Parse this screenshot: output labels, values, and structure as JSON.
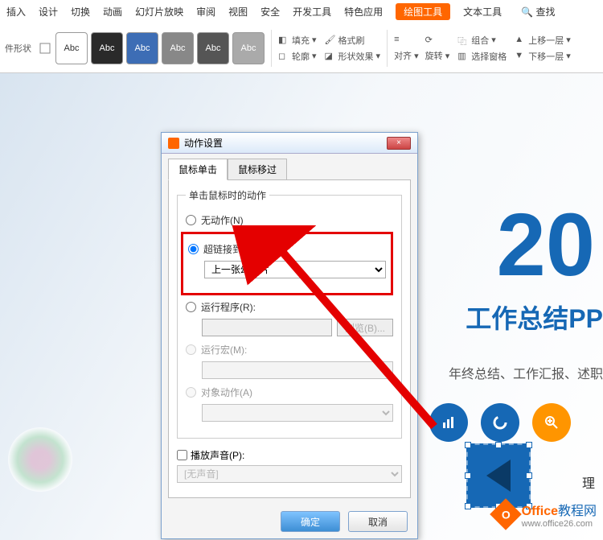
{
  "ribbon": {
    "tabs": [
      "插入",
      "设计",
      "切换",
      "动画",
      "幻灯片放映",
      "审阅",
      "视图",
      "安全",
      "开发工具",
      "特色应用",
      "绘图工具",
      "文本工具"
    ],
    "active_tab_index": 10,
    "search": "查找"
  },
  "toolbar": {
    "shape_label": "件形状",
    "abc": "Abc",
    "fill": "填充",
    "outline": "轮廓",
    "format_painter": "格式刷",
    "shape_effects": "形状效果",
    "align": "对齐",
    "rotate": "旋转",
    "group": "组合",
    "selection_pane": "选择窗格",
    "bring_forward": "上移一层",
    "send_backward": "下移一层"
  },
  "slide": {
    "big_number": "20",
    "big_title": "工作总结PP",
    "subtitle": "年终总结、工作汇报、述职",
    "reason": "理"
  },
  "dialog": {
    "title": "动作设置",
    "close": "×",
    "tab1": "鼠标单击",
    "tab2": "鼠标移过",
    "group_label": "单击鼠标时的动作",
    "opt_none": "无动作(N)",
    "opt_hyperlink": "超链接到(H):",
    "hyperlink_target": "上一张幻灯片",
    "opt_run_program": "运行程序(R):",
    "browse": "浏览(B)...",
    "opt_run_macro": "运行宏(M):",
    "opt_object_action": "对象动作(A)",
    "play_sound": "播放声音(P):",
    "sound_value": "[无声音]",
    "ok": "确定",
    "cancel": "取消"
  },
  "watermark": {
    "logo_letter": "O",
    "brand": "Office",
    "suffix": "教程网",
    "url": "www.office26.com"
  }
}
